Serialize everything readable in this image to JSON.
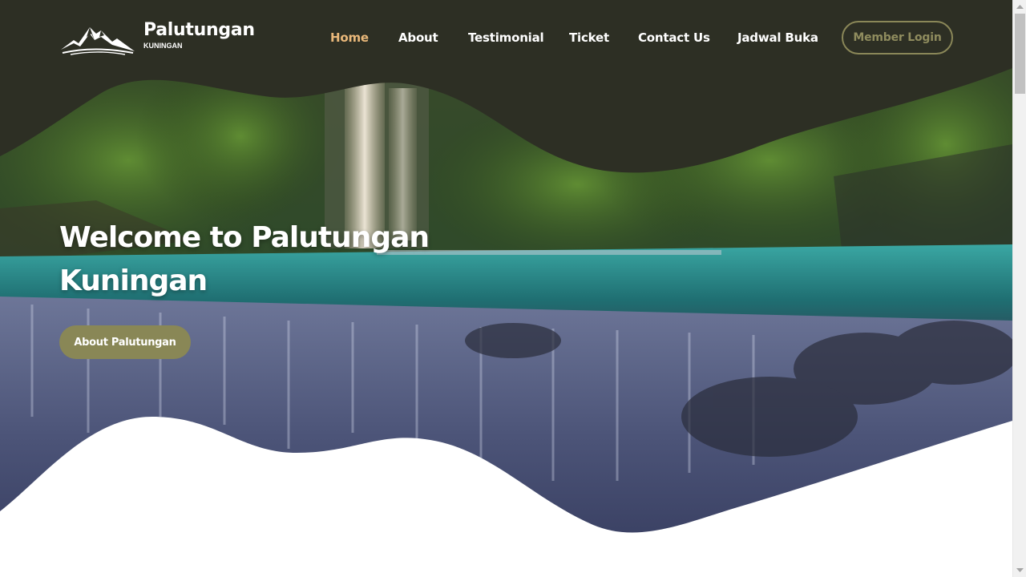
{
  "brand": {
    "title": "Palutungan",
    "subtitle": "KUNINGAN",
    "logo_icon": "mountain-logo-icon"
  },
  "nav": {
    "items": [
      {
        "label": "Home",
        "active": true
      },
      {
        "label": "About",
        "active": false
      },
      {
        "label": "Testimonial",
        "active": false
      },
      {
        "label": "Ticket",
        "active": false
      },
      {
        "label": "Contact Us",
        "active": false
      },
      {
        "label": "Jadwal Buka",
        "active": false
      }
    ],
    "login_label": "Member Login"
  },
  "hero": {
    "title_line1": "Welcome to Palutungan",
    "title_line2": "Kuningan",
    "button_label": "About Palutungan",
    "background": "waterfall-photo"
  },
  "colors": {
    "nav_bg": "#2d2f24",
    "active_link": "#e9b87a",
    "accent": "#898756",
    "text_light": "#ffffff"
  }
}
